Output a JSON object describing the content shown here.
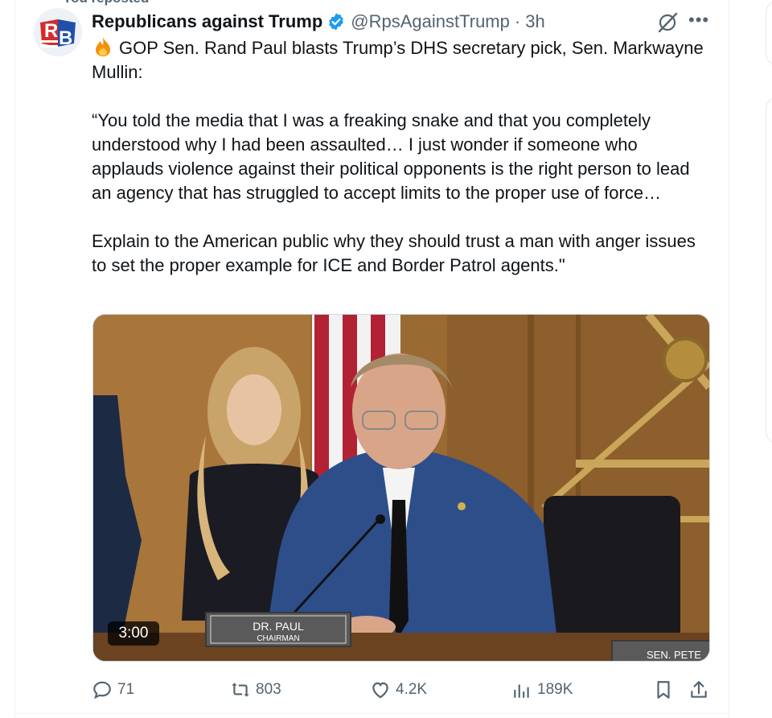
{
  "repost_banner": "You reposted",
  "author": {
    "name": "Republicans against Trump",
    "handle": "@RpsAgainstTrump",
    "separator": "·",
    "time": "3h",
    "avatar_letters": "RB"
  },
  "tweet": {
    "text": "GOP Sen. Rand Paul blasts Trump’s DHS secretary pick, Sen. Markwayne Mullin:\n\n“You told the media that I was a freaking snake and that you completely understood why I had been assaulted… I just wonder if someone who applauds violence against their political opponents is the right person to lead an agency that has struggled to accept limits to the proper use of force…\n\nExplain to the American public why they should trust a man with anger issues to set the proper example for ICE and Border Patrol agents.\""
  },
  "media": {
    "duration": "3:00",
    "nameplate_name": "DR. PAUL",
    "nameplate_title": "CHAIRMAN",
    "nameplate_right": "SEN. PETE"
  },
  "actions": {
    "replies": "71",
    "reposts": "803",
    "likes": "4.2K",
    "views": "189K"
  },
  "colors": {
    "text": "#0f1419",
    "muted": "#536471",
    "verified": "#1d9bf0",
    "repost_active": "#536471"
  }
}
